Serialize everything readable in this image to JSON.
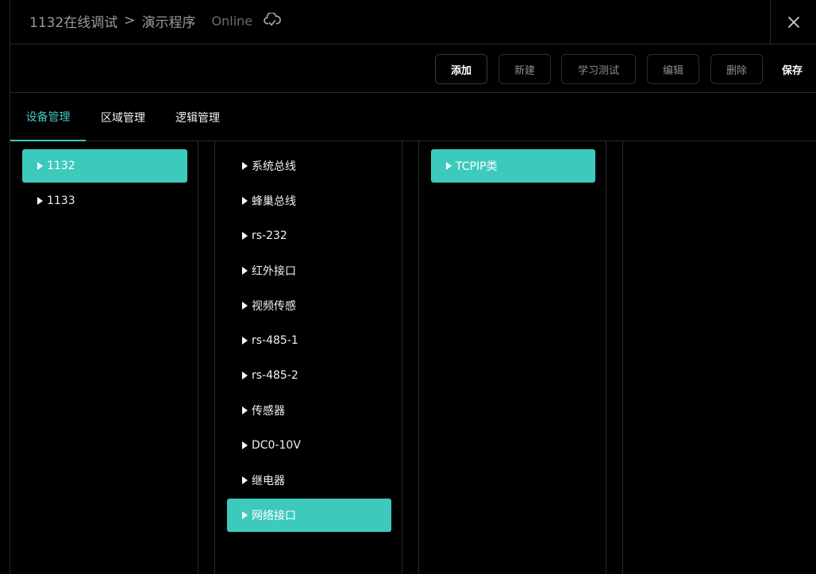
{
  "header": {
    "crumb1": "1132在线调试",
    "crumb_sep": ">",
    "crumb2": "演示程序",
    "status": "Online",
    "cloud_icon": "cloud-check-icon",
    "close_icon": "close-icon"
  },
  "toolbar": {
    "add_label": "添加",
    "new_label": "新建",
    "learn_test_label": "学习测试",
    "edit_label": "编辑",
    "delete_label": "删除",
    "save_label": "保存"
  },
  "tabs": [
    {
      "label": "设备管理",
      "active": true
    },
    {
      "label": "区域管理",
      "active": false
    },
    {
      "label": "逻辑管理",
      "active": false
    }
  ],
  "devices": [
    {
      "label": "1132",
      "selected": true
    },
    {
      "label": "1133",
      "selected": false
    }
  ],
  "interfaces": [
    {
      "label": "系统总线",
      "selected": false
    },
    {
      "label": "蜂巢总线",
      "selected": false
    },
    {
      "label": "rs-232",
      "selected": false
    },
    {
      "label": "红外接口",
      "selected": false
    },
    {
      "label": "视频传感",
      "selected": false
    },
    {
      "label": "rs-485-1",
      "selected": false
    },
    {
      "label": "rs-485-2",
      "selected": false
    },
    {
      "label": "传感器",
      "selected": false
    },
    {
      "label": "DC0-10V",
      "selected": false
    },
    {
      "label": "继电器",
      "selected": false
    },
    {
      "label": "网络接口",
      "selected": true
    }
  ],
  "types": [
    {
      "label": "TCPIP类",
      "selected": true
    }
  ],
  "colors": {
    "accent": "#3ec9bd",
    "background": "#000000",
    "border": "#2a2a2a"
  }
}
